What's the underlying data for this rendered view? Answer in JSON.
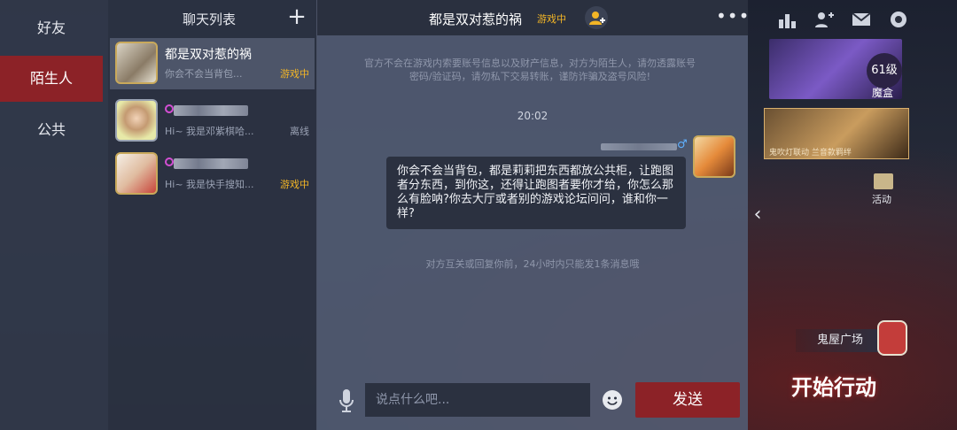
{
  "categories": [
    {
      "label": "好友",
      "active": false
    },
    {
      "label": "陌生人",
      "active": true
    },
    {
      "label": "公共",
      "active": false
    }
  ],
  "chat_list": {
    "title": "聊天列表",
    "add_icon": "plus-icon",
    "items": [
      {
        "name": "都是双对惹的祸",
        "preview": "你会不会当背包...",
        "status": "游戏中",
        "status_type": "ingame"
      },
      {
        "name": "",
        "preview": "Hi~ 我是邓紫棋哈...",
        "status": "离线",
        "status_type": "offline"
      },
      {
        "name": "",
        "preview": "Hi~ 我是快手搜知...",
        "status": "游戏中",
        "status_type": "ingame"
      }
    ]
  },
  "chat": {
    "title": "都是双对惹的祸",
    "status": "游戏中",
    "notice": "官方不会在游戏内索要账号信息以及财产信息，对方为陌生人，请勿透露账号密码/验证码，请勿私下交易转账，谨防诈骗及盗号风险!",
    "time": "20:02",
    "message": "你会不会当背包，都是莉莉把东西都放公共柜，让跑图者分东西，到你这，还得让跑图者要你才给，你怎么那么有脸呐?你去大厅或者别的游戏论坛问问，谁和你一样?",
    "gender_symbol": "♂",
    "hint": "对方互关或回复你前，24小时内只能发1条消息哦",
    "input_placeholder": "说点什么吧...",
    "send_label": "发送"
  },
  "side": {
    "level": "61级",
    "magic_box": "魔盒",
    "promo_caption": "鬼吹灯联动 兰音款羁绊",
    "activity": "活动",
    "ghost_house": "鬼屋广场",
    "start": "开始行动"
  },
  "colors": {
    "accent_red": "#8c2227",
    "status_ingame": "#f2b526",
    "status_offline": "#9aa2b4"
  }
}
